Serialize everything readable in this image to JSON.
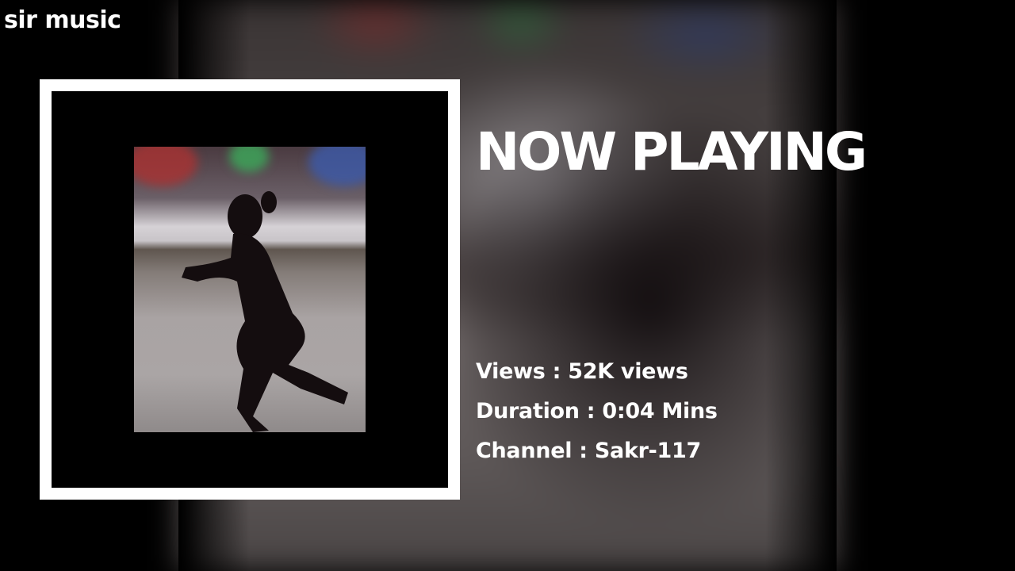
{
  "brand": {
    "name": "sir music"
  },
  "header": {
    "now_playing": "NOW PLAYING"
  },
  "track": {
    "views_label": "Views",
    "views_value": "52K views",
    "duration_label": "Duration",
    "duration_value": "0:04 Mins",
    "channel_label": "Channel",
    "channel_value": "Sakr-117",
    "separator": " : "
  },
  "colors": {
    "background": "#000000",
    "text": "#ffffff",
    "frame": "#ffffff"
  }
}
